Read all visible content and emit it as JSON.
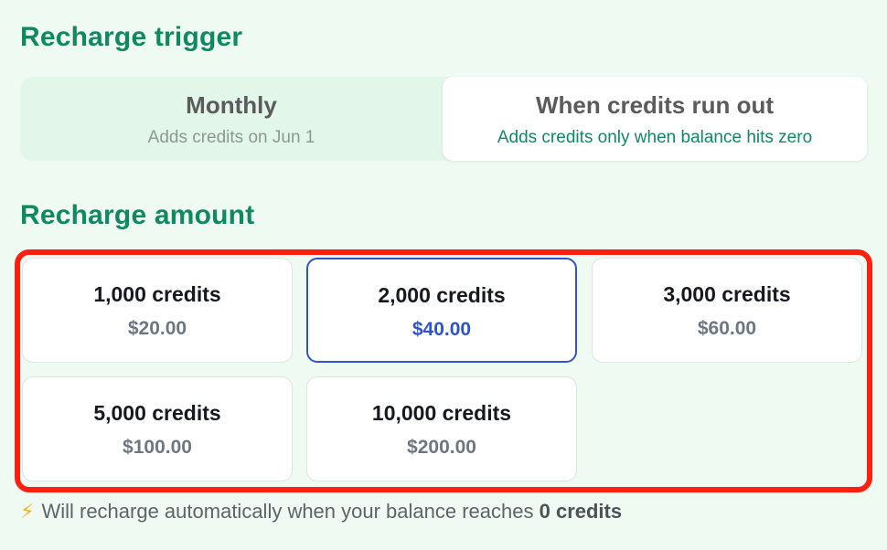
{
  "trigger": {
    "title": "Recharge trigger",
    "options": [
      {
        "title": "Monthly",
        "subtitle": "Adds credits on Jun 1",
        "selected": false
      },
      {
        "title": "When credits run out",
        "subtitle": "Adds credits only when balance hits zero",
        "selected": true
      }
    ]
  },
  "amount": {
    "title": "Recharge amount",
    "options": [
      {
        "credits": "1,000 credits",
        "price": "$20.00",
        "selected": false
      },
      {
        "credits": "2,000 credits",
        "price": "$40.00",
        "selected": true
      },
      {
        "credits": "3,000 credits",
        "price": "$60.00",
        "selected": false
      },
      {
        "credits": "5,000 credits",
        "price": "$100.00",
        "selected": false
      },
      {
        "credits": "10,000 credits",
        "price": "$200.00",
        "selected": false
      }
    ]
  },
  "footer": {
    "icon": "lightning-bolt-icon",
    "icon_glyph": "⚡",
    "text": "Will recharge automatically when your balance reaches ",
    "emphasis": "0 credits"
  },
  "colors": {
    "accent_green": "#0f8a5f",
    "selected_blue": "#2f52d0",
    "highlight_red": "#ff1f0f",
    "background": "#effaf3"
  }
}
